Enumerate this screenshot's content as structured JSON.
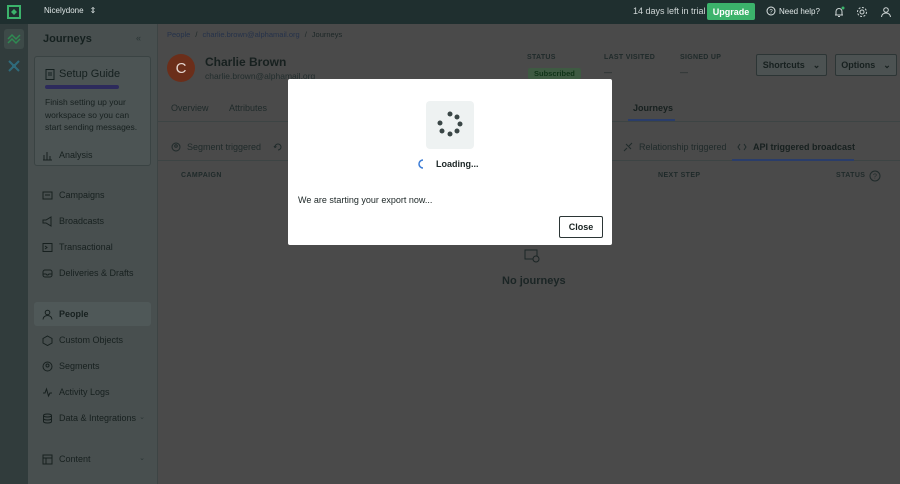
{
  "topbar": {
    "workspace": "Nicelydone",
    "trial_text": "14 days left in trial",
    "upgrade_label": "Upgrade",
    "help_label": "Need help?"
  },
  "sidebar": {
    "title": "Journeys",
    "setup_title": "Setup Guide",
    "setup_progress": 0.4,
    "setup_text": "Finish setting up your workspace so you can start sending messages.",
    "items": [
      {
        "label": "Analysis",
        "icon": "analysis-icon"
      },
      {
        "label": "Campaigns",
        "icon": "campaigns-icon"
      },
      {
        "label": "Broadcasts",
        "icon": "broadcasts-icon"
      },
      {
        "label": "Transactional",
        "icon": "transactional-icon"
      },
      {
        "label": "Deliveries & Drafts",
        "icon": "deliveries-icon"
      },
      {
        "label": "People",
        "icon": "people-icon"
      },
      {
        "label": "Custom Objects",
        "icon": "custom-objects-icon"
      },
      {
        "label": "Segments",
        "icon": "segments-icon"
      },
      {
        "label": "Activity Logs",
        "icon": "activity-logs-icon"
      },
      {
        "label": "Data & Integrations",
        "icon": "data-integrations-icon"
      },
      {
        "label": "Content",
        "icon": "content-icon"
      }
    ]
  },
  "breadcrumb": [
    "People",
    "/",
    "charlie.brown@alphamail.org",
    "/",
    "Journeys"
  ],
  "profile": {
    "initial": "C",
    "name": "Charlie Brown",
    "email": "charlie.brown@alphamail.org"
  },
  "stats": {
    "status_label": "STATUS",
    "status_value": "Subscribed",
    "last_visited_label": "LAST VISITED",
    "last_visited_value": "—",
    "signed_up_label": "SIGNED UP",
    "signed_up_value": "—"
  },
  "buttons": {
    "shortcuts": "Shortcuts",
    "options": "Options"
  },
  "tabs": [
    "Overview",
    "Attributes",
    "Journeys"
  ],
  "subtabs": [
    "Segment triggered",
    "Relationship triggered",
    "API triggered broadcast"
  ],
  "columns": [
    "CAMPAIGN",
    "NEXT STEP",
    "STATUS"
  ],
  "empty": {
    "text": "No journeys"
  },
  "modal": {
    "loading": "Loading...",
    "message": "We are starting your export now...",
    "close": "Close"
  },
  "colors": {
    "accent": "#3bb36b",
    "topbar": "#1f2f2f",
    "active_tab": "#2a3d6a"
  }
}
